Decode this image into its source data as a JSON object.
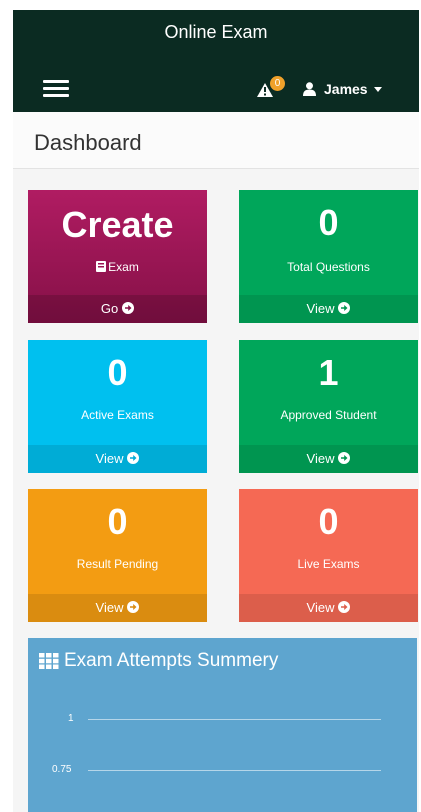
{
  "app": {
    "title": "Online Exam"
  },
  "header": {
    "notification_count": "0",
    "user_name": "James"
  },
  "page": {
    "title": "Dashboard"
  },
  "tiles": [
    {
      "value": "Create",
      "label": "Exam",
      "footer": "Go",
      "color": "#b01c62"
    },
    {
      "value": "0",
      "label": "Total Questions",
      "footer": "View",
      "color": "#00a65a"
    },
    {
      "value": "0",
      "label": "Active Exams",
      "footer": "View",
      "color": "#00c0ef"
    },
    {
      "value": "1",
      "label": "Approved Student",
      "footer": "View",
      "color": "#00a65a"
    },
    {
      "value": "0",
      "label": "Result Pending",
      "footer": "View",
      "color": "#f39c12"
    },
    {
      "value": "0",
      "label": "Live Exams",
      "footer": "View",
      "color": "#f56954"
    }
  ],
  "chart": {
    "title": "Exam Attempts Summery",
    "y_ticks": [
      "1",
      "0.75"
    ]
  },
  "icons": {
    "menu": "hamburger-icon",
    "alert": "warning-icon",
    "user": "user-icon",
    "exam": "book-icon",
    "arrow": "arrow-circle-right-icon",
    "grid": "th-icon"
  }
}
